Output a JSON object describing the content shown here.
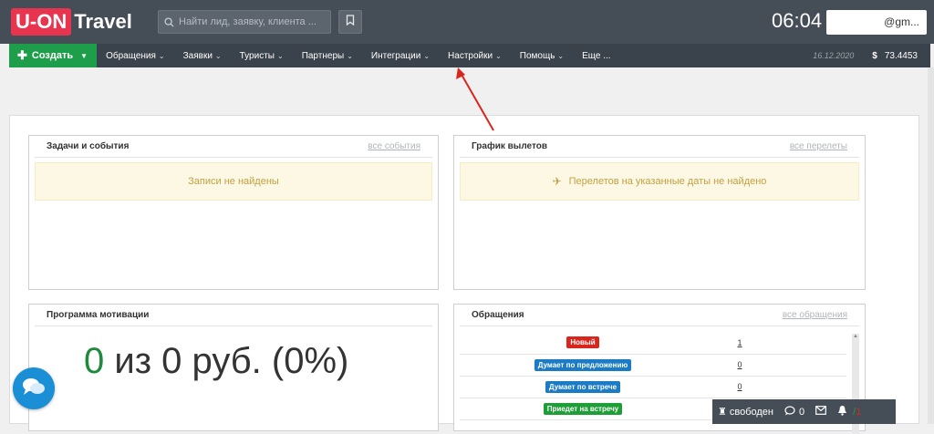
{
  "app": {
    "logo_box": "U-ON",
    "logo_text": "Travel"
  },
  "search": {
    "placeholder": "Найти лид, заявку, клиента ..."
  },
  "header": {
    "time": "06:04",
    "user": "@gm..."
  },
  "nav": {
    "create_label": "Создать",
    "items": [
      {
        "label": "Обращения"
      },
      {
        "label": "Заявки"
      },
      {
        "label": "Туристы"
      },
      {
        "label": "Партнеры"
      },
      {
        "label": "Интеграции"
      },
      {
        "label": "Настройки"
      },
      {
        "label": "Помощь"
      },
      {
        "label": "Еще ..."
      }
    ],
    "date": "16.12.2020",
    "currency_symbol": "$",
    "rate": "73.4453"
  },
  "panels": {
    "tasks": {
      "title": "Задачи и события",
      "link": "все события",
      "empty": "Записи не найдены"
    },
    "flights": {
      "title": "График вылетов",
      "link": "все перелеты",
      "empty": "Перелетов на указанные даты не найдено"
    },
    "motivation": {
      "title": "Программа мотивации",
      "value": "0",
      "rest": " из 0 руб. (0%)"
    },
    "requests": {
      "title": "Обращения",
      "link": "все обращения",
      "rows": [
        {
          "status": "Новый",
          "color": "#d9261c",
          "count": "1"
        },
        {
          "status": "Думает по предложению",
          "color": "#1b7bc4",
          "count": "0"
        },
        {
          "status": "Думает по встрече",
          "color": "#1b7bc4",
          "count": "0"
        },
        {
          "status": "Приедет на встречу",
          "color": "#1e9e36",
          "count": ""
        }
      ]
    }
  },
  "status_bar": {
    "state": "свободен",
    "messages": "0",
    "notify_count": "1"
  },
  "colors": {
    "topbar": "#454d57",
    "navbar": "#3a424b",
    "accent_green": "#1e9e4a",
    "logo_red": "#e8344e",
    "annotation_arrow": "#d9261c"
  }
}
